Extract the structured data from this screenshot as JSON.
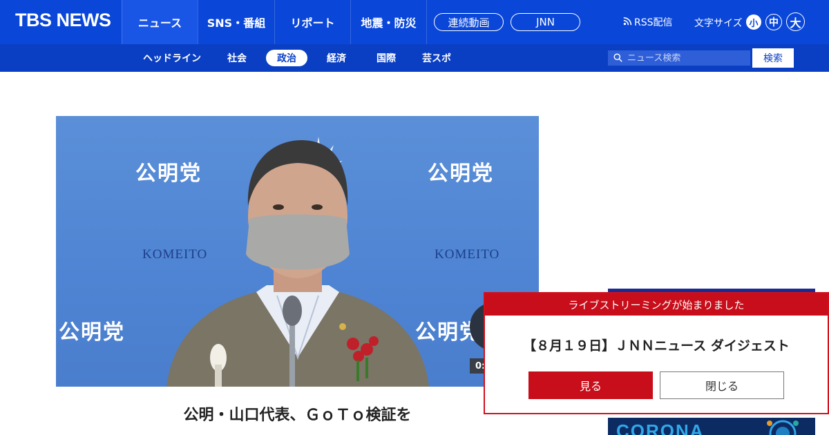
{
  "header": {
    "logo": "TBS NEWS",
    "tabs": [
      {
        "label": "ニュース",
        "active": true
      },
      {
        "label": "SNS・番組",
        "active": false
      },
      {
        "label": "リポート",
        "active": false
      },
      {
        "label": "地震・防災",
        "active": false
      }
    ],
    "pills": [
      "連続動画",
      "JNN"
    ],
    "rss_label": "RSS配信",
    "font_size_label": "文字サイズ",
    "font_sizes": [
      {
        "label": "小",
        "active": true
      },
      {
        "label": "中",
        "active": false
      },
      {
        "label": "大",
        "active": false
      }
    ]
  },
  "subnav": {
    "items": [
      {
        "label": "ヘッドライン",
        "active": false
      },
      {
        "label": "社会",
        "active": false
      },
      {
        "label": "政治",
        "active": true
      },
      {
        "label": "経済",
        "active": false
      },
      {
        "label": "国際",
        "active": false
      },
      {
        "label": "芸スポ",
        "active": false
      }
    ],
    "search_placeholder": "ニュース検索",
    "search_button": "検索"
  },
  "video": {
    "backdrop_party": "公明党",
    "backdrop_brand": "KOMEITO",
    "time_text": "0:"
  },
  "article": {
    "headline": "公明・山口代表、ＧｏＴｏ検証を"
  },
  "ad": {
    "bottom_text": "CORONA"
  },
  "popup": {
    "header": "ライブストリーミングが始まりました",
    "title": "【８月１９日】ＪＮＮニュース ダイジェスト",
    "watch_button": "見る",
    "close_button": "閉じる"
  },
  "colors": {
    "brand_blue": "#0a47d9",
    "subnav_blue": "#0a3fc4",
    "alert_red": "#c80e1a"
  }
}
